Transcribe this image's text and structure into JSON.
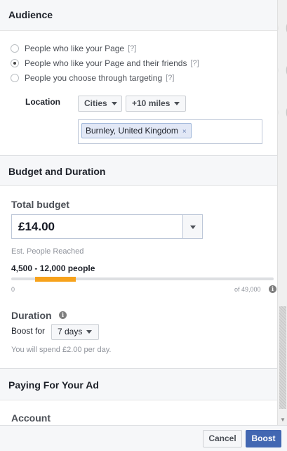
{
  "audience": {
    "title": "Audience",
    "options": [
      {
        "label": "People who like your Page",
        "help": "[?]",
        "selected": false
      },
      {
        "label": "People who like your Page and their friends",
        "help": "[?]",
        "selected": true
      },
      {
        "label": "People you choose through targeting",
        "help": "[?]",
        "selected": false
      }
    ],
    "location_label": "Location",
    "location_type": "Cities",
    "radius": "+10 miles",
    "location_token": "Burnley, United Kingdom",
    "token_remove": "×"
  },
  "budget": {
    "title": "Budget and Duration",
    "total_label": "Total budget",
    "total_value": "£14.00",
    "est_label": "Est. People Reached",
    "est_value": "4,500 - 12,000 people",
    "reach_min_label": "0",
    "reach_max_label": "of 49,000",
    "reach_range": {
      "low": 4500,
      "high": 12000,
      "max": 49000
    },
    "info_glyph": "i",
    "duration_label": "Duration",
    "boost_for_label": "Boost for",
    "duration_value": "7 days",
    "spend_note": "You will spend £2.00 per day."
  },
  "paying": {
    "title": "Paying For Your Ad",
    "account_label": "Account"
  },
  "footer": {
    "cancel_label": "Cancel",
    "boost_label": "Boost"
  },
  "colors": {
    "accent": "#4267b2",
    "reach_fill": "#f7a21b"
  },
  "icons": {
    "caret": "chevron-down-icon",
    "info": "info-icon",
    "remove": "close-icon"
  }
}
